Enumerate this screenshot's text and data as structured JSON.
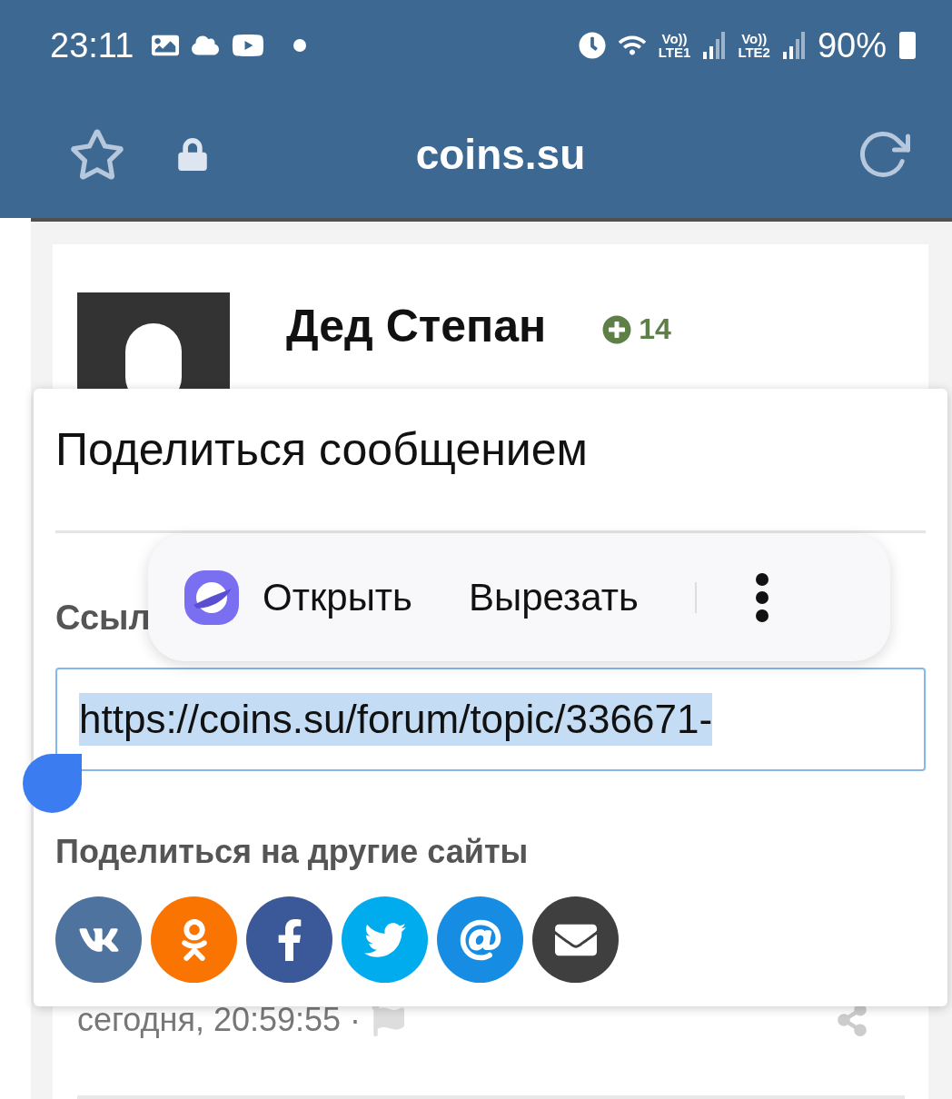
{
  "status_bar": {
    "time": "23:11",
    "network_labels": [
      {
        "top": "Vo))",
        "bottom": "LTE1"
      },
      {
        "top": "Vo))",
        "bottom": "LTE2"
      }
    ],
    "battery": "90%"
  },
  "address_bar": {
    "domain": "coins.su"
  },
  "post": {
    "author": "Дед Степан",
    "reputation": "14",
    "date": "сегодня, 20:59:55 ·"
  },
  "share_dialog": {
    "title": "Поделиться сообщением",
    "link_label": "Ссыл",
    "link_value": "https://coins.su/forum/topic/336671-",
    "other_sites_label": "Поделиться на другие сайты",
    "services": [
      {
        "kind": "vk",
        "color": "#4f739f"
      },
      {
        "kind": "ok",
        "color": "#f97400"
      },
      {
        "kind": "facebook",
        "color": "#3b5998"
      },
      {
        "kind": "twitter",
        "color": "#00aced"
      },
      {
        "kind": "mail",
        "color": "#168de2"
      },
      {
        "kind": "email",
        "color": "#3f3f3f"
      }
    ]
  },
  "context_menu": {
    "items": [
      {
        "kind": "app",
        "label": "Открыть"
      },
      {
        "kind": "text",
        "label": "Вырезать"
      }
    ]
  }
}
